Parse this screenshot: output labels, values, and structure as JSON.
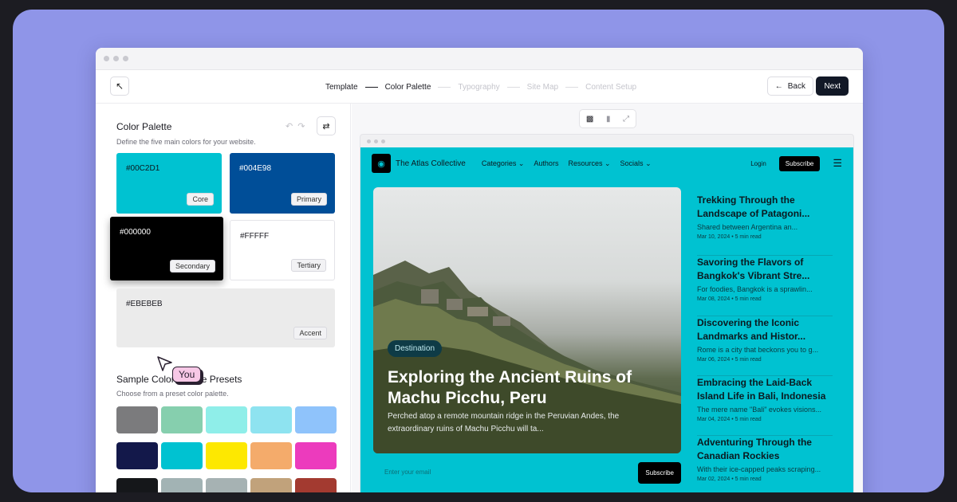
{
  "wizard": {
    "steps": [
      {
        "label": "Template",
        "done": true
      },
      {
        "label": "Color Palette",
        "active": true
      },
      {
        "label": "Typography",
        "done": false
      },
      {
        "label": "Site Map",
        "done": false
      },
      {
        "label": "Content Setup",
        "done": false
      }
    ],
    "back_label": "Back",
    "next_label": "Next"
  },
  "palette": {
    "title": "Color Palette",
    "subtitle": "Define the five main colors for your website.",
    "swatches": [
      {
        "hex": "#00C2D1",
        "role": "Core",
        "color": "#00C2D1",
        "text": "#0b1a20"
      },
      {
        "hex": "#004E98",
        "role": "Primary",
        "color": "#004E98",
        "text": "#ffffff"
      },
      {
        "hex": "#000000",
        "role": "Secondary",
        "color": "#000000",
        "text": "#ffffff"
      },
      {
        "hex": "#FFFFF",
        "role": "Tertiary",
        "color": "#ffffff",
        "text": "#1b1b22"
      },
      {
        "hex": "#EBEBEB",
        "role": "Accent",
        "color": "#EBEBEB",
        "text": "#1b1b22"
      }
    ]
  },
  "presets": {
    "title": "Sample Color Palette Presets",
    "subtitle": "Choose from a preset color palette.",
    "colors": [
      "#7b7b7d",
      "#86cfae",
      "#8feee9",
      "#8ee3f0",
      "#8fc3fb",
      "#13184a",
      "#00c2d1",
      "#fde801",
      "#f4ab6b",
      "#ec3bbd",
      "#15171a",
      "#a2b3b4",
      "#a6b2b3",
      "#c1a27b",
      "#a33a30"
    ]
  },
  "cursor": {
    "label": "You"
  },
  "site": {
    "brand": "The Atlas Collective",
    "nav": [
      "Categories",
      "Authors",
      "Resources",
      "Socials"
    ],
    "login": "Login",
    "subscribe": "Subscribe",
    "hero": {
      "tag": "Destination",
      "title": "Exploring the Ancient Ruins of Machu Picchu, Peru",
      "excerpt": "Perched atop a remote mountain ridge in the Peruvian Andes, the extraordinary ruins of Machu Picchu will ta..."
    },
    "email": {
      "placeholder": "Enter your email",
      "button": "Subscribe"
    },
    "articles": [
      {
        "title": "Trekking Through the Landscape of Patagoni...",
        "excerpt": "Shared between Argentina an...",
        "meta": "Mar 10, 2024 • 5 min read"
      },
      {
        "title": "Savoring the Flavors of Bangkok's Vibrant Stre...",
        "excerpt": "For foodies, Bangkok is a sprawlin...",
        "meta": "Mar 08, 2024 • 5 min read"
      },
      {
        "title": "Discovering the Iconic Landmarks and Histor...",
        "excerpt": "Rome is a city that beckons you to g...",
        "meta": "Mar 06, 2024 • 5 min read"
      },
      {
        "title": "Embracing the Laid-Back Island Life in Bali, Indonesia",
        "excerpt": "The mere name \"Bali\" evokes visions...",
        "meta": "Mar 04, 2024 • 5 min read"
      },
      {
        "title": "Adventuring Through the Canadian Rockies",
        "excerpt": "With their ice-capped peaks scraping...",
        "meta": "Mar 02, 2024 • 5 min read"
      }
    ]
  },
  "icons": {
    "exit": "arrow-up-left-icon",
    "undo": "undo-icon",
    "redo": "redo-icon",
    "shuffle": "shuffle-icon",
    "desktop": "desktop-icon",
    "mobile": "mobile-icon",
    "fullscreen": "fullscreen-icon",
    "menu": "hamburger-icon"
  }
}
